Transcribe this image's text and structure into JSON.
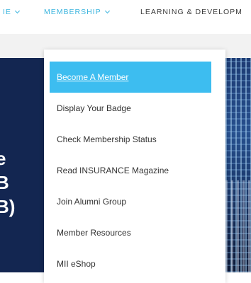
{
  "topnav": {
    "items": [
      {
        "label": "IE"
      },
      {
        "label": "MEMBERSHIP"
      },
      {
        "label": "LEARNING & DEVELOPM"
      }
    ]
  },
  "hero": {
    "lines": [
      "e",
      "B",
      "B)"
    ]
  },
  "dropdown": {
    "items": [
      {
        "label": "Become A Member"
      },
      {
        "label": "Display Your Badge"
      },
      {
        "label": "Check Membership Status"
      },
      {
        "label": "Read INSURANCE Magazine"
      },
      {
        "label": "Join Alumni Group"
      },
      {
        "label": "Member Resources"
      },
      {
        "label": "MII eShop"
      }
    ]
  },
  "colors": {
    "accent": "#3dbdf0",
    "nav_active": "#3ab4de",
    "hero_navy": "#132651"
  }
}
